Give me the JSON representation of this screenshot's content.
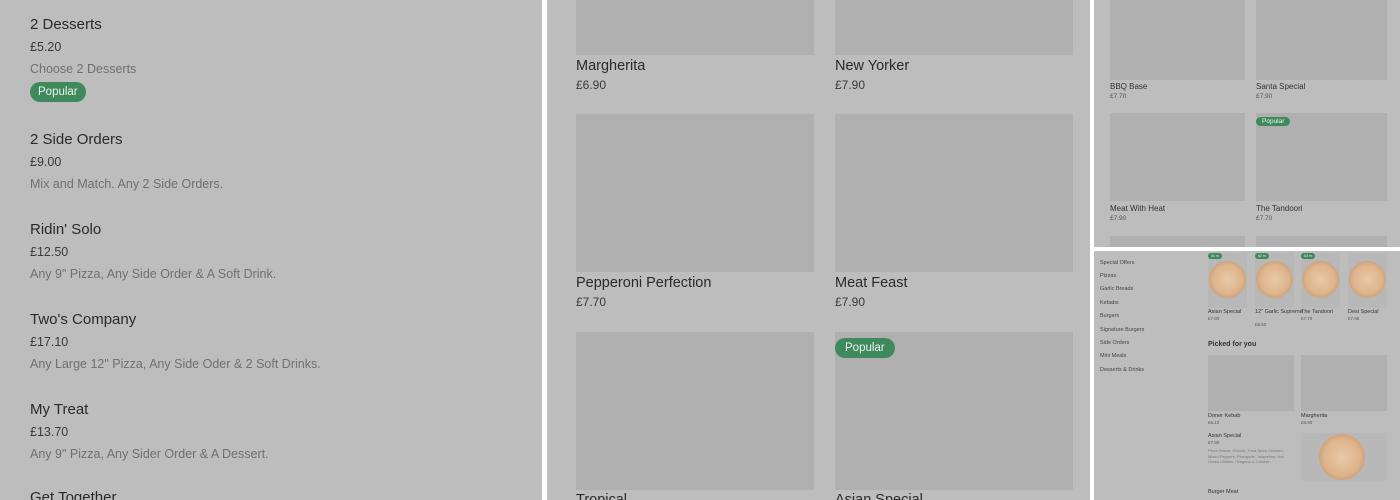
{
  "panel_a": {
    "items": [
      {
        "name": "2 Desserts",
        "price": "£5.20",
        "desc": "Choose 2 Desserts",
        "badge": "Popular"
      },
      {
        "name": "2 Side Orders",
        "price": "£9.00",
        "desc": "Mix and Match. Any 2 Side Orders."
      },
      {
        "name": "Ridin' Solo",
        "price": "£12.50",
        "desc": "Any 9\" Pizza, Any Side Order & A Soft Drink."
      },
      {
        "name": "Two's Company",
        "price": "£17.10",
        "desc": "Any Large 12\" Pizza, Any Side Oder & 2 Soft Drinks."
      },
      {
        "name": "My Treat",
        "price": "£13.70",
        "desc": "Any 9\" Pizza, Any Sider Order & A Dessert."
      },
      {
        "name": "Get Together"
      }
    ]
  },
  "panel_b": {
    "items": [
      {
        "name": "Margherita",
        "price": "£6.90"
      },
      {
        "name": "New Yorker",
        "price": "£7.90"
      },
      {
        "name": "Pepperoni Perfection",
        "price": "£7.70"
      },
      {
        "name": "Meat Feast",
        "price": "£7.90"
      },
      {
        "name": "Tropical"
      },
      {
        "name": "Asian Special",
        "badge": "Popular"
      }
    ]
  },
  "panel_c": {
    "items": [
      {
        "name": "BBQ Base",
        "price": "£7.70"
      },
      {
        "name": "Santa Special",
        "price": "£7.90"
      },
      {
        "name": "Meat With Heat",
        "price": "£7.90"
      },
      {
        "name": "The Tandoori",
        "price": "£7.70",
        "badge": "Popular"
      }
    ]
  },
  "panel_d": {
    "nav": [
      "Special Offers",
      "Pizzas",
      "Garlic Breads",
      "Kebabs",
      "Burgers",
      "Signature Burgers",
      "Side Orders",
      "Mini Meals",
      "Desserts & Drinks"
    ],
    "top": [
      {
        "name": "Asian Special",
        "price": "£7.90",
        "badge": "#1 m"
      },
      {
        "name": "12\" Garlic Supreme",
        "price": "£8.50",
        "badge": "#2 m"
      },
      {
        "name": "The Tandoori",
        "price": "£7.70",
        "badge": "#3 m"
      },
      {
        "name": "Desi Special",
        "price": "£7.90"
      }
    ],
    "picked_heading": "Picked for you",
    "picked": [
      {
        "name": "Doner Kebab",
        "price": "£6.10"
      },
      {
        "name": "Margherita",
        "price": "£6.90"
      }
    ],
    "asian": {
      "name": "Asian Special",
      "price": "£7.90",
      "desc": "Pizza Sauce, Onions, Tuna Spicy Chicken, Mixed Peppers, Pineapple, Jalapeños, Hot Green Chillies, Oregano & Cheese."
    },
    "burger_meal": "Burger Meal"
  }
}
